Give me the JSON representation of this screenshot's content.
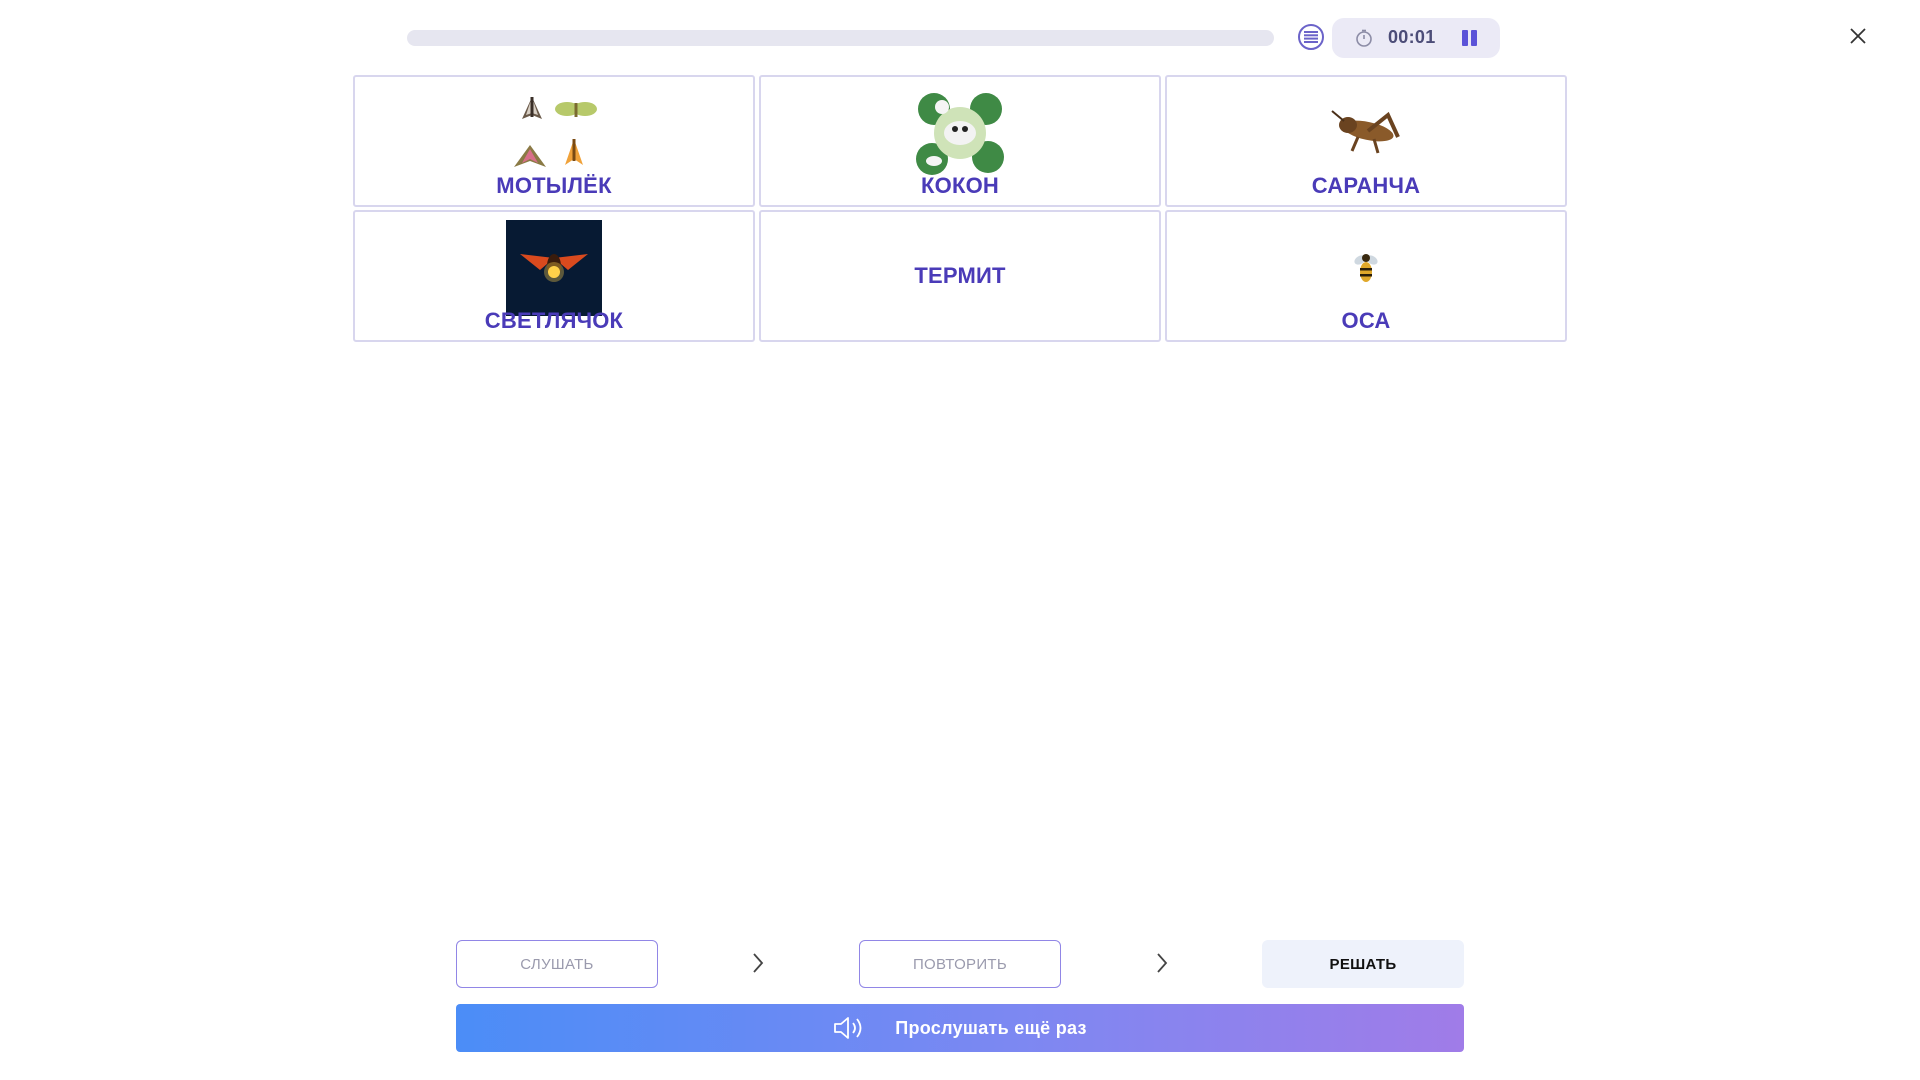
{
  "header": {
    "progress_fraction": 0,
    "timer": "00:01",
    "icons": {
      "list": "list-icon",
      "timer": "stopwatch-icon",
      "pause": "pause-icon",
      "close": "close-icon"
    },
    "accent_color": "#5b53d8"
  },
  "cards": [
    {
      "label": "МОТЫЛЁК",
      "image": "moths-image"
    },
    {
      "label": "КОКОН",
      "image": "cocoon-image"
    },
    {
      "label": "САРАНЧА",
      "image": "locust-image"
    },
    {
      "label": "СВЕТЛЯЧОК",
      "image": "firefly-image"
    },
    {
      "label": "ТЕРМИТ",
      "image": null
    },
    {
      "label": "ОСА",
      "image": "wasp-image"
    }
  ],
  "steps": [
    {
      "label": "СЛУШАТЬ",
      "state": "done"
    },
    {
      "label": "ПОВТОРИТЬ",
      "state": "done"
    },
    {
      "label": "РЕШАТЬ",
      "state": "active"
    }
  ],
  "listen_again": {
    "label": "Прослушать ещё раз",
    "icon": "speaker-icon"
  },
  "colors": {
    "card_label": "#4a3bb8",
    "card_border": "#d8d6ee",
    "button_gradient": [
      "#4b8df7",
      "#a07ce8"
    ]
  }
}
